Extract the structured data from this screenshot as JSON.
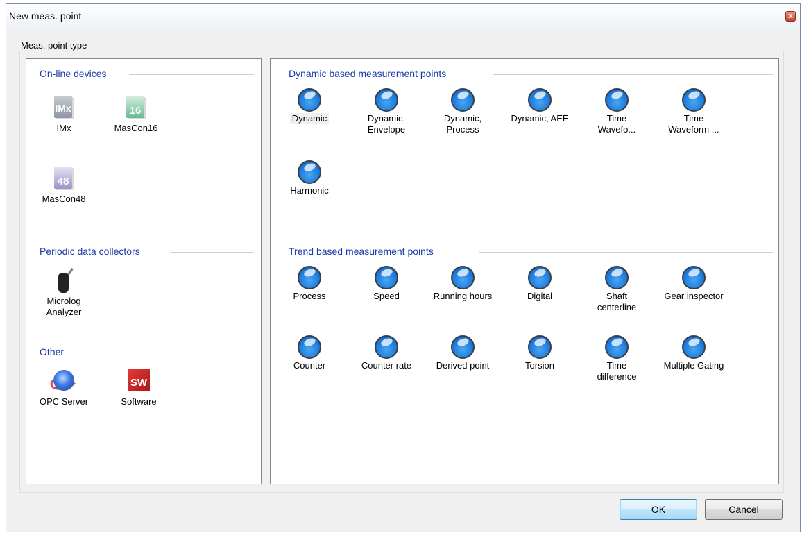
{
  "window": {
    "title": "New meas. point",
    "close_glyph": "x"
  },
  "group_label": "Meas. point type",
  "left_panel": {
    "online": {
      "title": "On-line devices",
      "items": [
        {
          "label": "IMx",
          "icon_text": "IMx",
          "icon": "imx-device-icon"
        },
        {
          "label": "MasCon16",
          "icon_text": "16",
          "icon": "mascon16-device-icon"
        },
        {
          "label": "MasCon48",
          "icon_text": "48",
          "icon": "mascon48-device-icon"
        }
      ]
    },
    "periodic": {
      "title": "Periodic data collectors",
      "items": [
        {
          "label": "Microlog Analyzer",
          "icon": "microlog-analyzer-icon"
        }
      ]
    },
    "other": {
      "title": "Other",
      "items": [
        {
          "label": "OPC Server",
          "icon": "opc-server-icon"
        },
        {
          "label": "Software",
          "icon_text": "SW",
          "icon": "software-icon"
        }
      ]
    }
  },
  "right_panel": {
    "dynamic": {
      "title": "Dynamic based measurement points",
      "items": [
        "Dynamic",
        "Dynamic,\nEnvelope",
        "Dynamic,\nProcess",
        "Dynamic, AEE",
        "Time\nWavefo...",
        "Time\nWaveform ...",
        "Harmonic"
      ]
    },
    "trend": {
      "title": "Trend based measurement points",
      "items": [
        "Process",
        "Speed",
        "Running hours",
        "Digital",
        "Shaft\ncenterline",
        "Gear inspector",
        "Counter",
        "Counter rate",
        "Derived point",
        "Torsion",
        "Time\ndifference",
        "Multiple Gating"
      ]
    }
  },
  "buttons": {
    "ok": "OK",
    "cancel": "Cancel"
  },
  "colors": {
    "section_title": "#1c3aa9",
    "ball": "#1f7ee0"
  }
}
